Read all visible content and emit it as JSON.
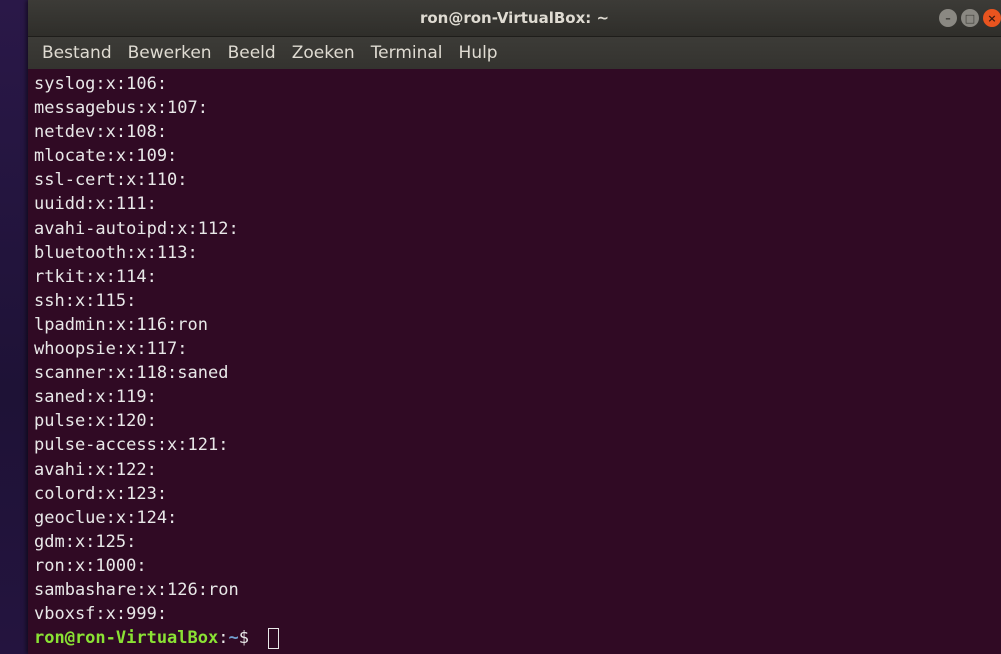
{
  "window": {
    "title": "ron@ron-VirtualBox: ~"
  },
  "controls": {
    "minimize_glyph": "–",
    "maximize_glyph": "□",
    "close_glyph": "×"
  },
  "menubar": {
    "items": [
      "Bestand",
      "Bewerken",
      "Beeld",
      "Zoeken",
      "Terminal",
      "Hulp"
    ]
  },
  "terminal": {
    "lines": [
      "syslog:x:106:",
      "messagebus:x:107:",
      "netdev:x:108:",
      "mlocate:x:109:",
      "ssl-cert:x:110:",
      "uuidd:x:111:",
      "avahi-autoipd:x:112:",
      "bluetooth:x:113:",
      "rtkit:x:114:",
      "ssh:x:115:",
      "lpadmin:x:116:ron",
      "whoopsie:x:117:",
      "scanner:x:118:saned",
      "saned:x:119:",
      "pulse:x:120:",
      "pulse-access:x:121:",
      "avahi:x:122:",
      "colord:x:123:",
      "geoclue:x:124:",
      "gdm:x:125:",
      "ron:x:1000:",
      "sambashare:x:126:ron",
      "vboxsf:x:999:"
    ],
    "prompt": {
      "user_host": "ron@ron-VirtualBox",
      "separator": ":",
      "path": "~",
      "sign": "$ "
    }
  },
  "colors": {
    "terminal_bg": "#300a24",
    "prompt_user": "#8ae234",
    "prompt_path": "#729fcf",
    "close_button": "#e9541f"
  }
}
